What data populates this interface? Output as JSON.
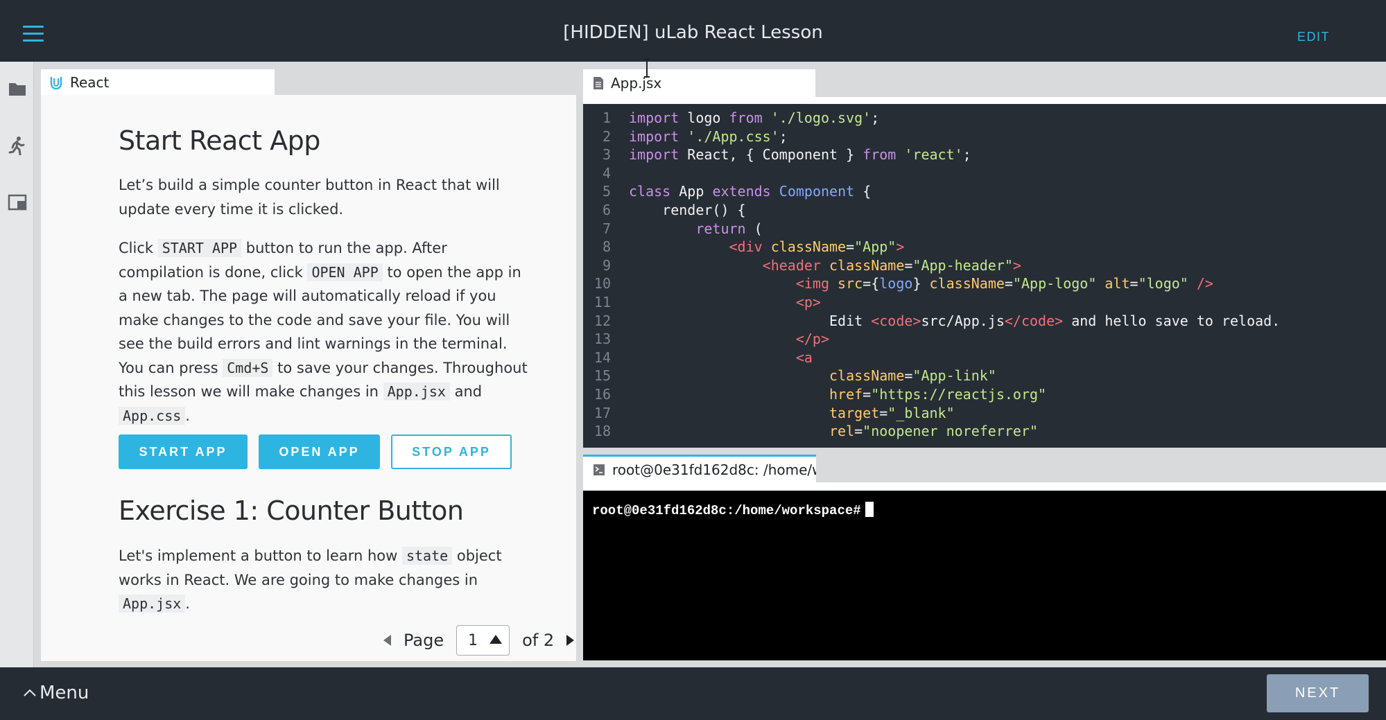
{
  "header": {
    "title": "[HIDDEN] uLab React Lesson",
    "edit_label": "EDIT"
  },
  "rail": {
    "icons": [
      "folder-icon",
      "runner-icon",
      "window-icon"
    ]
  },
  "lesson": {
    "tab_label": "React",
    "heading1": "Start React App",
    "para1": "Let’s build a simple counter button in React that will update every time it is clicked.",
    "para2": {
      "t1": "Click ",
      "c1": "START APP",
      "t2": " button to run the app. After compilation is done, click ",
      "c2": "OPEN APP",
      "t3": " to open the app in a new tab. The page will automatically reload if you make changes to the code and save your file. You will see the build errors and lint warnings in the terminal. You can press ",
      "c3": "Cmd+S",
      "t4": " to save your changes. Throughout this lesson we will make changes in ",
      "c4": "App.jsx",
      "t5": " and ",
      "c5": "App.css",
      "t6": "."
    },
    "buttons": {
      "start": "START APP",
      "open": "OPEN APP",
      "stop": "STOP APP"
    },
    "heading2": "Exercise 1: Counter Button",
    "para3": {
      "t1": "Let's implement a button to learn how ",
      "c1": "state",
      "t2": " object works in React. We are going to make changes in ",
      "c2": "App.jsx",
      "t3": "."
    },
    "pager": {
      "page_label": "Page",
      "current": "1",
      "of_label": "of 2"
    }
  },
  "editor": {
    "tab_label": "App.jsx",
    "line_numbers": [
      "1",
      "2",
      "3",
      "4",
      "5",
      "6",
      "7",
      "8",
      "9",
      "10",
      "11",
      "12",
      "13",
      "14",
      "15",
      "16",
      "17",
      "18"
    ]
  },
  "terminal": {
    "tab_label": "root@0e31fd162d8c: /home/w",
    "prompt": "root@0e31fd162d8c:/home/workspace#"
  },
  "footer": {
    "menu_label": "Menu",
    "next_label": "NEXT"
  },
  "colors": {
    "accent": "#2eb4e0",
    "topbar": "#252c34",
    "editor_bg": "#272d35",
    "next_button": "#8a9fb5"
  }
}
